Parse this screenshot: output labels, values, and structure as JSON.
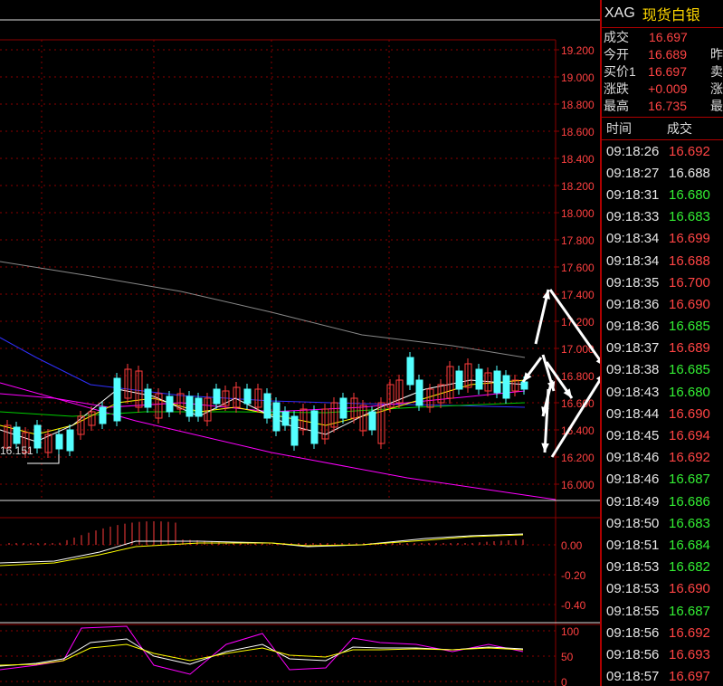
{
  "chart": {
    "price_axis": [
      "19.200",
      "19.000",
      "18.800",
      "18.600",
      "18.400",
      "18.200",
      "18.000",
      "17.800",
      "17.600",
      "17.400",
      "17.200",
      "17.000",
      "16.800",
      "16.600",
      "16.400",
      "16.200",
      "16.000"
    ],
    "low_label": "16.151",
    "macd_axis": [
      "0.00",
      "-0.20",
      "-0.40"
    ],
    "kdj_axis": [
      "100",
      "50",
      "0"
    ],
    "colors": {
      "grid": "#8b0000",
      "up": "#ff3b3b",
      "down": "#54ffff",
      "ma5": "#ffffff",
      "ma10": "#ffff00",
      "ma20": "#ff00ff",
      "ma30": "#00cc00",
      "ma60": "#3030ff",
      "ma250": "#888888"
    }
  },
  "panel": {
    "symbol": "XAG",
    "name": "现货白银",
    "quotes": [
      {
        "label": "成交",
        "value": "16.697",
        "color": "red",
        "extra": ""
      },
      {
        "label": "今开",
        "value": "16.689",
        "color": "red",
        "extra": "昨"
      },
      {
        "label": "买价1",
        "value": "16.697",
        "color": "red",
        "extra": "卖"
      },
      {
        "label": "涨跌",
        "value": "+0.009",
        "color": "red",
        "extra": "涨"
      },
      {
        "label": "最高",
        "value": "16.735",
        "color": "red",
        "extra": "最"
      }
    ],
    "tick_header": {
      "time": "时间",
      "price": "成交"
    },
    "ticks": [
      {
        "time": "09:18:26",
        "price": "16.692",
        "color": "red"
      },
      {
        "time": "09:18:27",
        "price": "16.688",
        "color": "white"
      },
      {
        "time": "09:18:31",
        "price": "16.680",
        "color": "green"
      },
      {
        "time": "09:18:33",
        "price": "16.683",
        "color": "green"
      },
      {
        "time": "09:18:34",
        "price": "16.699",
        "color": "red"
      },
      {
        "time": "09:18:34",
        "price": "16.688",
        "color": "red"
      },
      {
        "time": "09:18:35",
        "price": "16.700",
        "color": "red"
      },
      {
        "time": "09:18:36",
        "price": "16.690",
        "color": "red"
      },
      {
        "time": "09:18:36",
        "price": "16.685",
        "color": "green"
      },
      {
        "time": "09:18:37",
        "price": "16.689",
        "color": "red"
      },
      {
        "time": "09:18:38",
        "price": "16.685",
        "color": "green"
      },
      {
        "time": "09:18:43",
        "price": "16.680",
        "color": "green"
      },
      {
        "time": "09:18:44",
        "price": "16.690",
        "color": "red"
      },
      {
        "time": "09:18:45",
        "price": "16.694",
        "color": "red"
      },
      {
        "time": "09:18:46",
        "price": "16.692",
        "color": "red"
      },
      {
        "time": "09:18:46",
        "price": "16.687",
        "color": "green"
      },
      {
        "time": "09:18:49",
        "price": "16.686",
        "color": "green"
      },
      {
        "time": "09:18:50",
        "price": "16.683",
        "color": "green"
      },
      {
        "time": "09:18:51",
        "price": "16.684",
        "color": "green"
      },
      {
        "time": "09:18:53",
        "price": "16.682",
        "color": "green"
      },
      {
        "time": "09:18:53",
        "price": "16.690",
        "color": "red"
      },
      {
        "time": "09:18:55",
        "price": "16.687",
        "color": "green"
      },
      {
        "time": "09:18:56",
        "price": "16.692",
        "color": "red"
      },
      {
        "time": "09:18:56",
        "price": "16.693",
        "color": "red"
      },
      {
        "time": "09:18:57",
        "price": "16.697",
        "color": "red"
      }
    ]
  }
}
